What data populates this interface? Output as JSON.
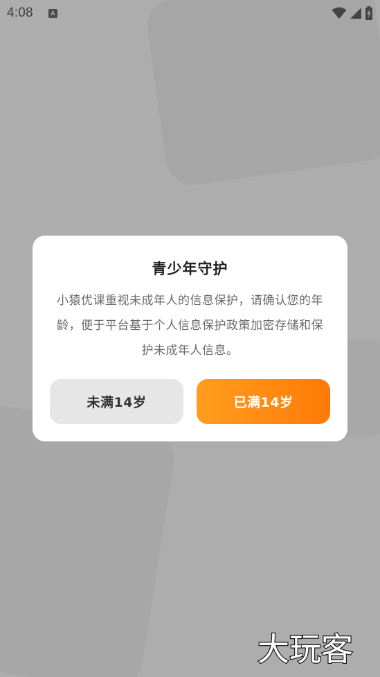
{
  "status_bar": {
    "time": "4:08",
    "notification_icon": "a-box-icon",
    "icons": [
      "wifi-icon",
      "cell-signal-icon",
      "battery-charging-icon"
    ]
  },
  "dialog": {
    "title": "青少年守护",
    "body": "小猿优课重视未成年人的信息保护，请确认您的年龄，便于平台基于个人信息保护政策加密存储和保护未成年人信息。",
    "under_button_label": "未满14岁",
    "over_button_label": "已满14岁"
  },
  "watermark": {
    "text": "大玩客"
  },
  "colors": {
    "overlay_background": "#adadad",
    "dialog_background": "#ffffff",
    "secondary_button": "#e6e6e6",
    "primary_gradient_start": "#ff9d1f",
    "primary_gradient_end": "#ff7a08"
  }
}
